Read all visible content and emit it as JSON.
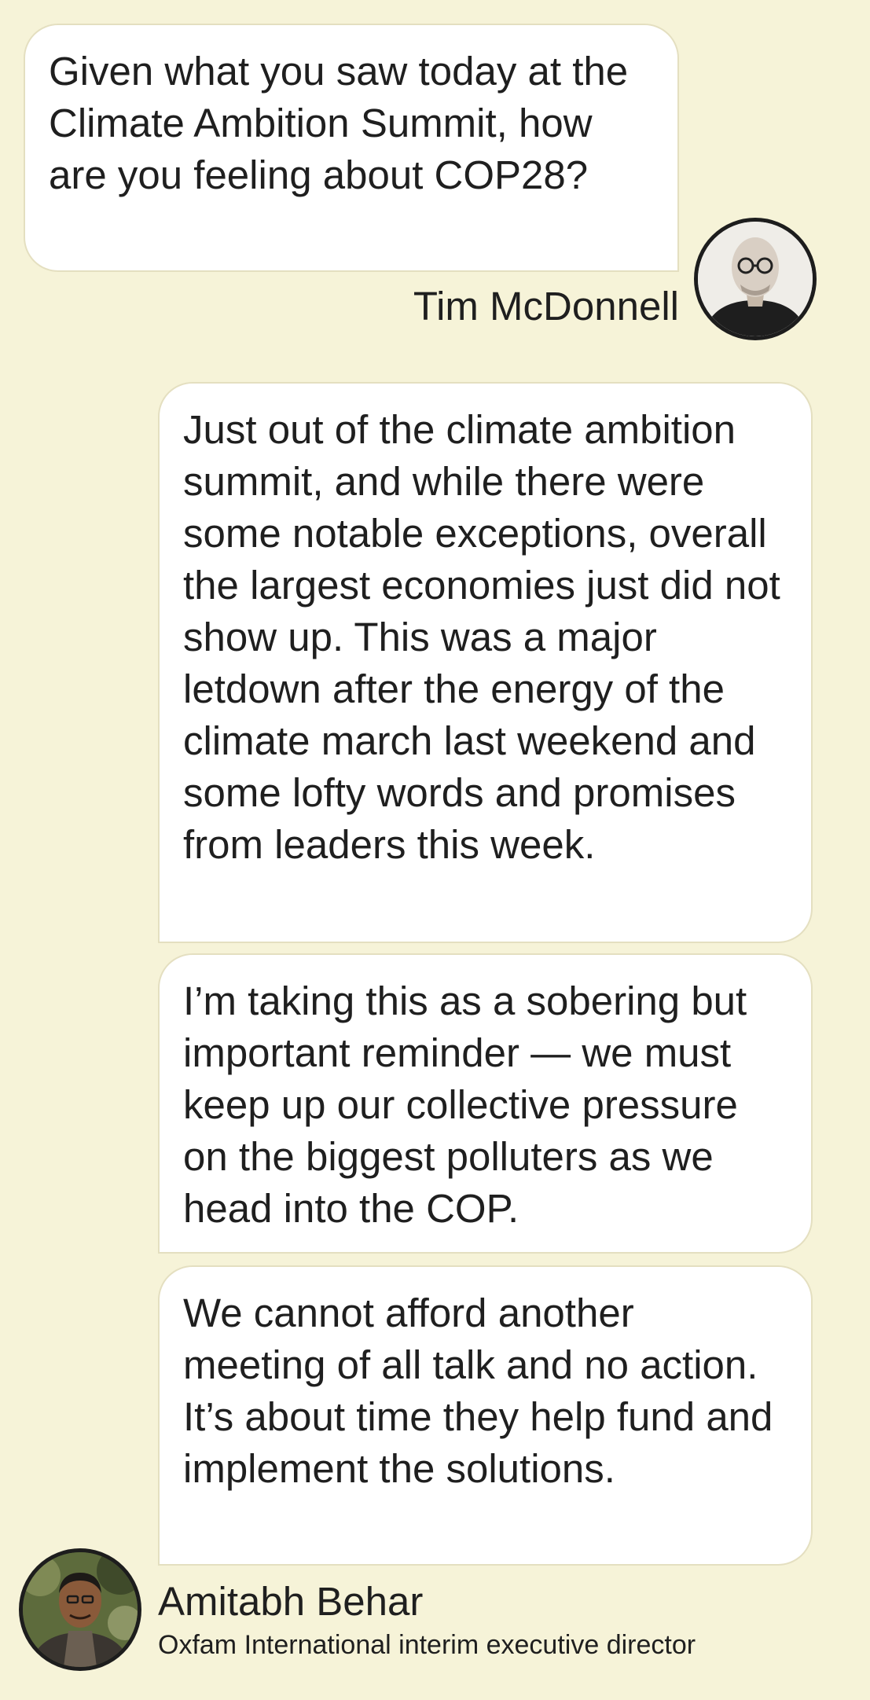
{
  "conversation": {
    "question": {
      "text": "Given what you saw today at the Climate Ambition Summit, how are you feeling about COP28?",
      "author": "Tim McDonnell"
    },
    "answers": [
      "Just out of the climate ambition summit, and while there were some notable exceptions, overall the largest economies just did not show up. This was a major letdown after the energy of the climate march last weekend and some lofty words and promises from leaders this week.",
      "I’m taking this as a sobering but important reminder — we must keep up our collective pressure on the biggest polluters as we head into the COP.",
      "We cannot afford another meeting of all talk and no action. It’s about time they help fund and implement the solutions."
    ],
    "respondent": {
      "name": "Amitabh Behar",
      "title": "Oxfam International interim executive director"
    }
  },
  "colors": {
    "background": "#f6f3d8",
    "bubble": "#ffffff",
    "bubble_border": "#e4dfc0",
    "text": "#1f1f1f",
    "avatar_ring": "#1d1d1d"
  },
  "icons": {
    "question_avatar": "portrait-photo-tim-mcdonnell",
    "answer_avatar": "portrait-photo-amitabh-behar"
  }
}
